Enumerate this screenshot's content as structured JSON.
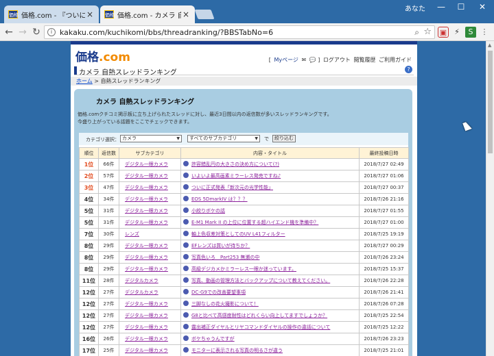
{
  "browser": {
    "tabs": [
      {
        "favicon": "価格",
        "title": "価格.com - 『ついに正式発",
        "active": false
      },
      {
        "favicon": "価格",
        "title": "価格.com - カメラ 自熱スレ",
        "active": true
      }
    ],
    "user_label": "あなた",
    "window_controls": {
      "minimize": "—",
      "maximize": "☐",
      "close": "✕"
    },
    "nav": {
      "back": "←",
      "forward": "→",
      "reload": "↻"
    },
    "url": "kakaku.com/kuchikomi/bbs/threadranking/?BBSTabNo=6",
    "zoom_icon": "⌕",
    "star_icon": "☆",
    "ext_icons": [
      "▣",
      "⚡",
      "S",
      "⋮"
    ]
  },
  "site": {
    "logo_main": "価格",
    "logo_dot": ".com",
    "header_links": {
      "mypage": "Myページ",
      "logout": "ログアウト",
      "history": "閲覧履歴",
      "guide": "ご利用ガイド"
    },
    "page_heading": "カメラ 自熱スレッドランキング",
    "breadcrumb": {
      "home": "ホーム",
      "sep": " > ",
      "current": "自熱スレッドランキング"
    }
  },
  "panel": {
    "title": "カメラ 自熱スレッドランキング",
    "desc_line1": "価格.comクチコミ掲示板に立ち上げられたスレッドに対し、最近3日間以内の返信数が多いスレッドランキングです。",
    "desc_line2": "今盛り上がっている話題をここでチェックできます。"
  },
  "filter": {
    "label": "カテゴリ選択：",
    "category": "カメラ",
    "subcategory": "すべてのサブカテゴリ",
    "de": "で",
    "button": "絞り込む"
  },
  "table": {
    "headers": [
      "順位",
      "返信数",
      "サブカテゴリ",
      "内容・タイトル",
      "最終投稿日時"
    ],
    "rows": [
      {
        "rank": "1位",
        "count": "66件",
        "sub": "デジタル一眼カメラ",
        "title": "許容錯乱円の大きさの決め方について(?)",
        "date": "2018/7/27 02:49"
      },
      {
        "rank": "2位",
        "count": "57件",
        "sub": "デジタル一眼カメラ",
        "title": "いよいよ最高画素ミラーレス発売ですね♪",
        "date": "2018/7/27 01:06"
      },
      {
        "rank": "3位",
        "count": "47件",
        "sub": "デジタル一眼カメラ",
        "title": "ついに正式発表「新次元の光学性能」",
        "date": "2018/7/27 00:37"
      },
      {
        "rank": "4位",
        "count": "34件",
        "sub": "デジタル一眼カメラ",
        "title": "EOS 5DmarkIV は？？？",
        "date": "2018/7/26 21:16"
      },
      {
        "rank": "5位",
        "count": "31件",
        "sub": "デジタル一眼カメラ",
        "title": "小絞りボケの話",
        "date": "2018/7/27 01:55"
      },
      {
        "rank": "5位",
        "count": "31件",
        "sub": "デジタル一眼カメラ",
        "title": "E-M1 Mark II の上位に位置する超ハイエンド機を準備中？",
        "date": "2018/7/27 01:00"
      },
      {
        "rank": "7位",
        "count": "30件",
        "sub": "レンズ",
        "title": "軸上色収差対策としてのUV L41フィルター",
        "date": "2018/7/25 19:19"
      },
      {
        "rank": "8位",
        "count": "29件",
        "sub": "デジタル一眼カメラ",
        "title": "EFレンズは買いが待ちか？",
        "date": "2018/7/27 00:29"
      },
      {
        "rank": "8位",
        "count": "29件",
        "sub": "デジタル一眼カメラ",
        "title": "写真色いろ　Part253 無瀬の中",
        "date": "2018/7/26 23:24"
      },
      {
        "rank": "8位",
        "count": "29件",
        "sub": "デジタル一眼カメラ",
        "title": "高級デジカメかミラーレス一眼か迷っています。",
        "date": "2018/7/25 15:37"
      },
      {
        "rank": "11位",
        "count": "28件",
        "sub": "デジタルカメラ",
        "title": "写真、動画の管理方法とバックアップについて教えてください。",
        "date": "2018/7/26 22:28"
      },
      {
        "rank": "12位",
        "count": "27件",
        "sub": "デジタルカメラ",
        "title": "DC-G9での改善要望事項",
        "date": "2018/7/26 21:41"
      },
      {
        "rank": "12位",
        "count": "27件",
        "sub": "デジタル一眼カメラ",
        "title": "三脚なしの花火撮影について！",
        "date": "2018/7/26 07:28"
      },
      {
        "rank": "12位",
        "count": "27件",
        "sub": "デジタル一眼カメラ",
        "title": "G8と比べて高感度耐性はどれくらい向上してますでしょうか？",
        "date": "2018/7/25 22:54"
      },
      {
        "rank": "12位",
        "count": "27件",
        "sub": "デジタル一眼カメラ",
        "title": "露出補正ダイヤルとリヤコマンドダイヤルの操作の違話について",
        "date": "2018/7/25 12:22"
      },
      {
        "rank": "16位",
        "count": "26件",
        "sub": "デジタル一眼カメラ",
        "title": "ボケちゃうんですが",
        "date": "2018/7/26 23:23"
      },
      {
        "rank": "17位",
        "count": "25件",
        "sub": "デジタル一眼カメラ",
        "title": "モニターに表示される写真の明るさが違う",
        "date": "2018/7/25 21:01"
      }
    ]
  }
}
